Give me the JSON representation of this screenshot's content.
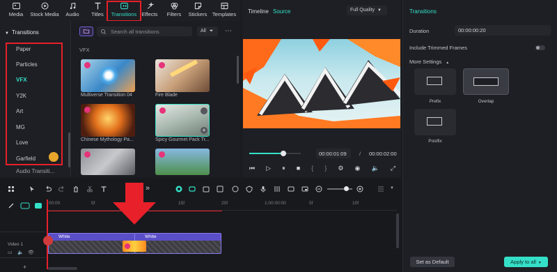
{
  "toolbar": {
    "tabs": [
      {
        "label": "Media",
        "icon": "media-icon"
      },
      {
        "label": "Stock Media",
        "icon": "stock-media-icon"
      },
      {
        "label": "Audio",
        "icon": "audio-icon"
      },
      {
        "label": "Titles",
        "icon": "titles-icon"
      },
      {
        "label": "Transitions",
        "icon": "transitions-icon"
      },
      {
        "label": "Effects",
        "icon": "effects-icon"
      },
      {
        "label": "Filters",
        "icon": "filters-icon"
      },
      {
        "label": "Stickers",
        "icon": "stickers-icon"
      },
      {
        "label": "Templates",
        "icon": "templates-icon"
      }
    ],
    "active_tab": "Transitions"
  },
  "sidebar": {
    "header": "Transitions",
    "items": [
      "Paper",
      "Particles",
      "VFX",
      "Y2K",
      "Art",
      "MG",
      "Love",
      "Garfield",
      "Audio Transiti..."
    ],
    "active": "VFX"
  },
  "grid": {
    "search_placeholder": "Search all transitions",
    "filter_label": "All",
    "section_label": "VFX",
    "items": [
      {
        "label": "Multiverse Transition 04"
      },
      {
        "label": "Fire Blade"
      },
      {
        "label": "Chinese Mythology Pa..."
      },
      {
        "label": "Spicy Gourmet Pack Tr..."
      },
      {
        "label": ""
      },
      {
        "label": ""
      }
    ]
  },
  "preview": {
    "tab_timeline": "Timeline",
    "tab_source": "Source",
    "quality": "Full Quality",
    "current_time": "00:00:01:09",
    "separator": "/",
    "total_time": "00:00:02:00"
  },
  "properties": {
    "title": "Transitions",
    "duration_label": "Duration",
    "duration_value": "00:00:00:20",
    "include_trimmed_label": "Include Trimmed Frames",
    "more_settings_label": "More Settings",
    "modes": [
      {
        "label": "Prefix"
      },
      {
        "label": "Overlap"
      },
      {
        "label": "Postfix"
      }
    ],
    "set_default_label": "Set as Default",
    "apply_all_label": "Apply to all"
  },
  "timeline": {
    "ruler_labels": [
      "00:00",
      "5f",
      "10f",
      "15f",
      "20f",
      "1:00:00:00",
      "5f",
      "10f"
    ],
    "track_label": "Video 1",
    "clip1_label": "White",
    "clip2_label": "White"
  },
  "colors": {
    "accent": "#34e0c8",
    "highlight": "#e8202a",
    "clip": "#5b4fc8"
  }
}
